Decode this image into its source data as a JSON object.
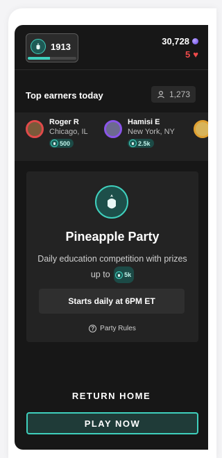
{
  "header": {
    "score": "1913",
    "score_progress": 0.45,
    "gems": "30,728",
    "lives": "5",
    "gem_icon": "gem-icon",
    "heart_icon": "heart-icon"
  },
  "earners": {
    "title": "Top earners today",
    "count": "1,273",
    "list": [
      {
        "name": "Roger R",
        "city": "Chicago, IL",
        "prize": "500",
        "ring_color": "#e04a4a",
        "avatar_color": "#7a5a3a"
      },
      {
        "name": "Hamisi E",
        "city": "New York, NY",
        "prize": "2.5k",
        "ring_color": "#8a55e8",
        "avatar_color": "#6d6a8f"
      }
    ]
  },
  "card": {
    "title": "Pineapple Party",
    "description": "Daily education competition with prizes up to",
    "prize": "5k",
    "starts": "Starts daily at 6PM ET",
    "rules": "Party Rules"
  },
  "actions": {
    "return_home": "RETURN HOME",
    "play_now": "PLAY NOW"
  },
  "colors": {
    "accent": "#3fd0bd",
    "danger": "#ef4a4a",
    "background": "#171717"
  }
}
